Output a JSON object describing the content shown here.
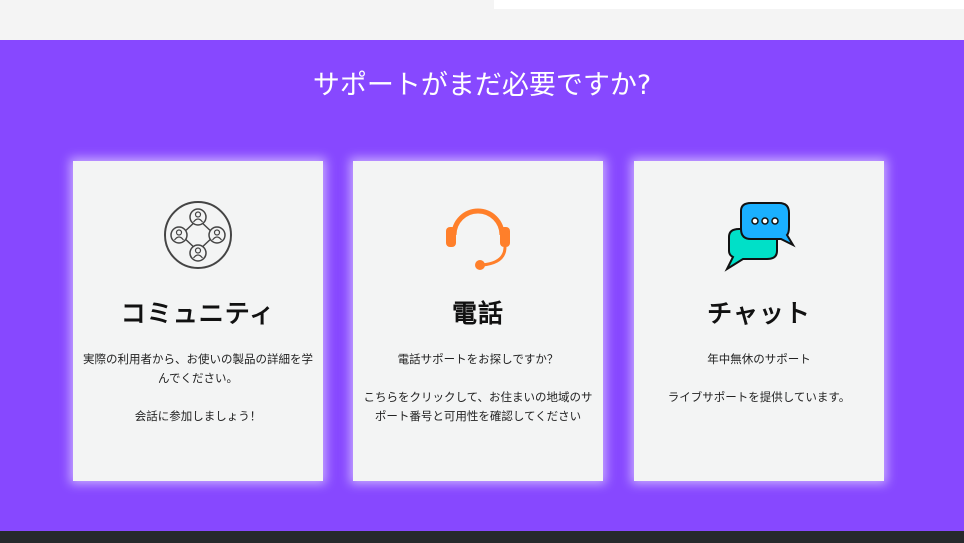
{
  "section": {
    "title": "サポートがまだ必要ですか?",
    "background": "#8748ff"
  },
  "cards": [
    {
      "icon": "community-icon",
      "title": "コミュニティ",
      "text1": "実際の利用者から、お使いの製品の詳細を学んでください。",
      "text2": "会話に参加しましょう！"
    },
    {
      "icon": "headset-icon",
      "title": "電話",
      "text1": "電話サポートをお探しですか？",
      "text2": "こちらをクリックして、お住まいの地域のサポート番号と可用性を確認してください"
    },
    {
      "icon": "chat-bubbles-icon",
      "title": "チャット",
      "text1": "年中無休のサポート",
      "text2": "ライブサポートを提供しています。"
    }
  ],
  "colors": {
    "card_background": "#f3f4f4",
    "headset_orange": "#ff7f2a",
    "chat_blue": "#1ab0ff",
    "chat_teal": "#00e0c8",
    "footer": "#26292c"
  }
}
